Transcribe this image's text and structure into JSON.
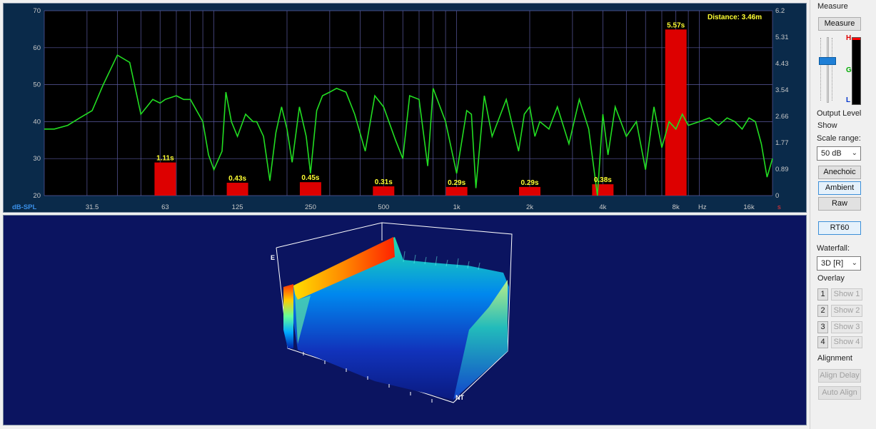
{
  "chart": {
    "left_unit": "dB-SPL",
    "right_unit": "s",
    "hz_label": "Hz",
    "distance": "Distance: 3.46m",
    "y_left_ticks": [
      "70",
      "60",
      "50",
      "40",
      "30",
      "20"
    ],
    "y_right_ticks": [
      "6.2",
      "5.31",
      "4.43",
      "3.54",
      "2.66",
      "1.77",
      "0.89",
      "0"
    ],
    "x_ticks": [
      "31.5",
      "63",
      "125",
      "250",
      "500",
      "1k",
      "2k",
      "4k",
      "8k",
      "16k"
    ],
    "rt60_labels": [
      "1.11s",
      "0.43s",
      "0.45s",
      "0.31s",
      "0.29s",
      "0.29s",
      "0.38s",
      "5.57s"
    ]
  },
  "chart_data": {
    "type": "bar",
    "categories": [
      "63",
      "125",
      "250",
      "500",
      "1k",
      "2k",
      "4k",
      "8k"
    ],
    "values": [
      1.11,
      0.43,
      0.45,
      0.31,
      0.29,
      0.29,
      0.38,
      5.57
    ],
    "ylabel": "s",
    "ylim": [
      0,
      6.2
    ],
    "xlabel": "Hz",
    "x_scale": "log",
    "series": [
      {
        "values_freq_hz": [
          20,
          22,
          25,
          28,
          31.5,
          35,
          40,
          45,
          50,
          56,
          60,
          63,
          70,
          75,
          80,
          90,
          95,
          100,
          108,
          112,
          118,
          125,
          135,
          145,
          150,
          160,
          170,
          180,
          190,
          200,
          210,
          225,
          240,
          250,
          265,
          280,
          300,
          320,
          350,
          380,
          420,
          460,
          500,
          560,
          600,
          640,
          700,
          760,
          800,
          900,
          1000,
          1100,
          1150,
          1200,
          1300,
          1400,
          1600,
          1800,
          1900,
          2000,
          2100,
          2200,
          2400,
          2600,
          2900,
          3200,
          3500,
          3800,
          4000,
          4200,
          4500,
          5000,
          5500,
          6000,
          6500,
          7000,
          7500,
          8000,
          8500,
          9000,
          10000,
          11000,
          12000,
          13000,
          14000,
          15000,
          16000,
          17000,
          18000,
          19000,
          20000
        ],
        "values_db": [
          38,
          38,
          39,
          41,
          43,
          50,
          58,
          56,
          42,
          46,
          45,
          46,
          47,
          46,
          46,
          40,
          31,
          27,
          32,
          48,
          40,
          36,
          42,
          40,
          40,
          36,
          24,
          37,
          44,
          38,
          29,
          44,
          36,
          26,
          43,
          47,
          48,
          49,
          48,
          42,
          32,
          47,
          44,
          35,
          30,
          47,
          46,
          28,
          49,
          40,
          26,
          43,
          42,
          22,
          47,
          36,
          46,
          32,
          42,
          44,
          36,
          40,
          38,
          44,
          34,
          46,
          38,
          20,
          42,
          31,
          44,
          36,
          40,
          27,
          44,
          33,
          40,
          38,
          42,
          39,
          40,
          41,
          39,
          41,
          40,
          38,
          41,
          40,
          34,
          25,
          30
        ]
      }
    ]
  },
  "waterfall": {
    "axis_e": "E",
    "axis_nt": "NT"
  },
  "side": {
    "measure_title": "Measure",
    "measure_button": "Measure",
    "meter_h": "H",
    "meter_g": "G",
    "meter_l": "L",
    "output_level": "Output Level",
    "show_title": "Show",
    "scale_range_label": "Scale range:",
    "scale_range_value": "50 dB",
    "anechoic": "Anechoic",
    "ambient": "Ambient",
    "raw": "Raw",
    "rt60": "RT60",
    "waterfall_label": "Waterfall:",
    "waterfall_value": "3D [R]",
    "overlay_title": "Overlay",
    "overlay": [
      {
        "num": "1",
        "label": "Show 1"
      },
      {
        "num": "2",
        "label": "Show 2"
      },
      {
        "num": "3",
        "label": "Show 3"
      },
      {
        "num": "4",
        "label": "Show 4"
      }
    ],
    "alignment_title": "Alignment",
    "align_delay": "Align Delay",
    "auto_align": "Auto Align"
  },
  "colors": {
    "bar": "#dd0000",
    "curve": "#22dd22",
    "label_yellow": "#ffff33",
    "grid": "#5a5aa0",
    "plot_bg": "#000000"
  }
}
